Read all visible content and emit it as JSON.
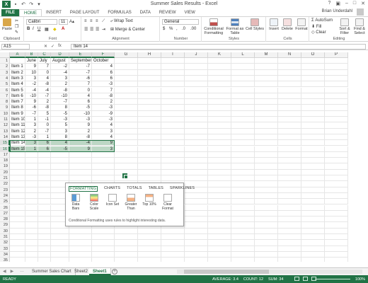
{
  "app": {
    "window_title": "Summer Sales Results - Excel",
    "user_name": "Brian Underdahl"
  },
  "ribbon_tabs": [
    "FILE",
    "HOME",
    "INSERT",
    "PAGE LAYOUT",
    "FORMULAS",
    "DATA",
    "REVIEW",
    "VIEW"
  ],
  "ribbon": {
    "paste": "Paste",
    "clipboard_label": "Clipboard",
    "font_name": "Calibri",
    "font_size": "11",
    "font_label": "Font",
    "wrap_text": "Wrap Text",
    "merge_center": "Merge & Center",
    "alignment_label": "Alignment",
    "number_format": "General",
    "number_label": "Number",
    "conditional_formatting": "Conditional Formatting",
    "format_as_table": "Format as Table",
    "cell_styles": "Cell Styles",
    "styles_label": "Styles",
    "insert": "Insert",
    "delete": "Delete",
    "format": "Format",
    "cells_label": "Cells",
    "autosum": "AutoSum",
    "fill": "Fill",
    "clear": "Clear",
    "sort_filter": "Sort & Filter",
    "find_select": "Find & Select",
    "editing_label": "Editing"
  },
  "formula_bar": {
    "name_box": "A15",
    "fx": "fx",
    "content": "Item 14"
  },
  "sheet": {
    "columns": [
      "A",
      "B",
      "C",
      "D",
      "E",
      "F",
      "G",
      "H",
      "I",
      "J",
      "K",
      "L",
      "M",
      "N",
      "O",
      "P"
    ],
    "rows": [
      [
        "",
        "June",
        "July",
        "August",
        "September",
        "October"
      ],
      [
        "Item 1",
        "9",
        "7",
        "-2",
        "-7",
        "4"
      ],
      [
        "Item 2",
        "10",
        "0",
        "-4",
        "-7",
        "6"
      ],
      [
        "Item 3",
        "3",
        "4",
        "3",
        "-6",
        "6"
      ],
      [
        "Item 4",
        "-2",
        "-8",
        "2",
        "7",
        "-3"
      ],
      [
        "Item 5",
        "-4",
        "-4",
        "-8",
        "0",
        "7"
      ],
      [
        "Item 6",
        "-10",
        "-7",
        "-10",
        "4",
        "-8"
      ],
      [
        "Item 7",
        "9",
        "2",
        "-7",
        "6",
        "2"
      ],
      [
        "Item 8",
        "-6",
        "-8",
        "8",
        "-5",
        "-3"
      ],
      [
        "Item 9",
        "-7",
        "5",
        "-5",
        "-10",
        "-9"
      ],
      [
        "Item 10",
        "1",
        "-1",
        "-3",
        "-3",
        "-3"
      ],
      [
        "Item 11",
        "3",
        "0",
        "5",
        "9",
        "4"
      ],
      [
        "Item 12",
        "2",
        "-7",
        "3",
        "2",
        "3"
      ],
      [
        "Item 13",
        "-3",
        "1",
        "8",
        "-8",
        "4"
      ],
      [
        "Item 14",
        "3",
        "6",
        "4",
        "-4",
        "9"
      ],
      [
        "Item 15",
        "1",
        "6",
        "-5",
        "9",
        "3"
      ]
    ],
    "row_count": 35
  },
  "quick_analysis": {
    "tabs": [
      "FORMATTING",
      "CHARTS",
      "TOTALS",
      "TABLES",
      "SPARKLINES"
    ],
    "items": [
      "Data Bars",
      "Color Scale",
      "Icon Set",
      "Greater Than",
      "Top 10%",
      "Clear Format"
    ],
    "note": "Conditional Formatting uses rules to highlight interesting data."
  },
  "sheet_tabs": [
    "Summer Sales Chart",
    "Sheet2",
    "Sheet1"
  ],
  "status": {
    "ready": "READY",
    "average": "AVERAGE: 3.4",
    "count": "COUNT: 12",
    "sum": "SUM: 34",
    "zoom": "100%"
  },
  "colors": {
    "accent": "#217346",
    "selection": "#bdd7c5"
  }
}
